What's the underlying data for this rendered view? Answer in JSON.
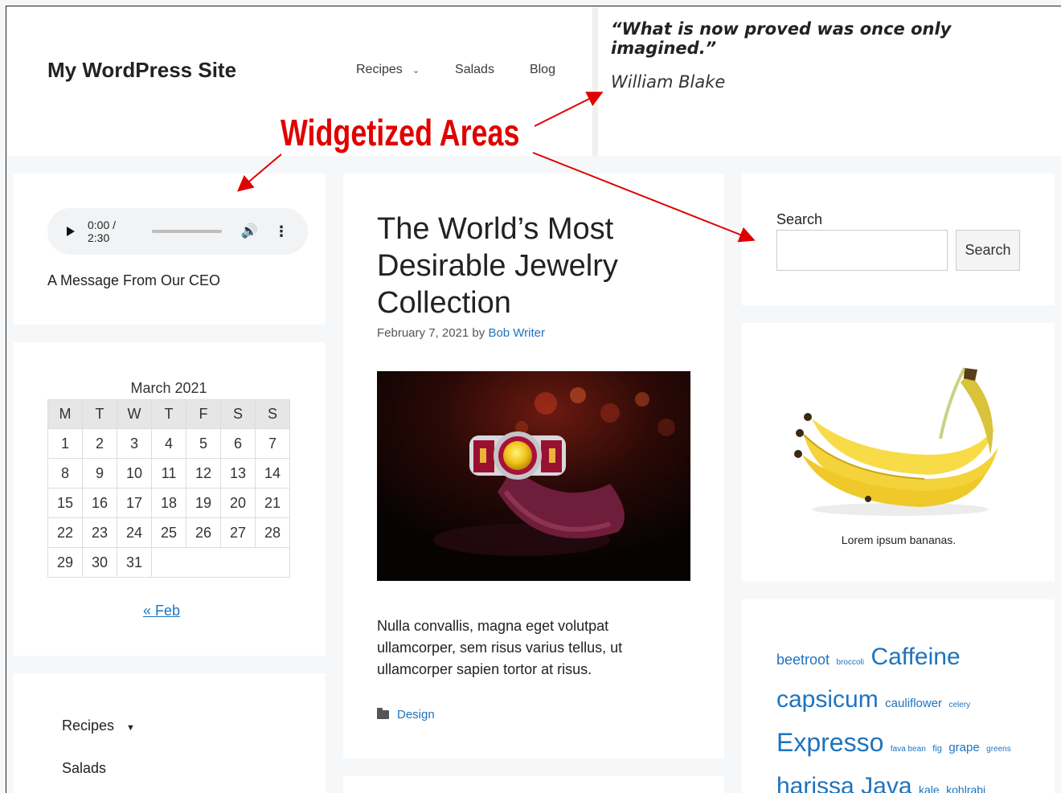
{
  "header": {
    "site_title": "My WordPress Site",
    "nav": [
      {
        "label": "Recipes",
        "has_submenu": true
      },
      {
        "label": "Salads",
        "has_submenu": false
      },
      {
        "label": "Blog",
        "has_submenu": false
      }
    ],
    "quote": "“What is now proved was once only imagined.”",
    "quote_author": "William Blake"
  },
  "annotation": {
    "label": "Widgetized Areas",
    "color": "#e00000"
  },
  "audio_widget": {
    "time": "0:00 / 2:30",
    "progress": 0,
    "caption": "A Message From Our CEO"
  },
  "calendar": {
    "caption": "March 2021",
    "weekdays": [
      "M",
      "T",
      "W",
      "T",
      "F",
      "S",
      "S"
    ],
    "weeks": [
      [
        "1",
        "2",
        "3",
        "4",
        "5",
        "6",
        "7"
      ],
      [
        "8",
        "9",
        "10",
        "11",
        "12",
        "13",
        "14"
      ],
      [
        "15",
        "16",
        "17",
        "18",
        "19",
        "20",
        "21"
      ],
      [
        "22",
        "23",
        "24",
        "25",
        "26",
        "27",
        "28"
      ],
      [
        "29",
        "30",
        "31",
        "",
        "",
        "",
        ""
      ]
    ],
    "prev_link": "« Feb"
  },
  "menu_widget": {
    "items": [
      {
        "label": "Recipes",
        "has_submenu": true
      },
      {
        "label": "Salads",
        "has_submenu": false
      }
    ]
  },
  "post": {
    "title": "The World’s Most Desirable Jewelry Collection",
    "date": "February 7, 2021",
    "by": "by",
    "author": "Bob Writer",
    "excerpt": "Nulla convallis, magna eget volutpat ullamcorper, sem risus varius tellus, ut ullamcorper sapien tortor at risus.",
    "category": "Design"
  },
  "search_widget": {
    "label": "Search",
    "value": "",
    "button_label": "Search"
  },
  "image_widget": {
    "caption": "Lorem ipsum bananas."
  },
  "tag_cloud": {
    "tags": [
      {
        "label": "beetroot",
        "size": 18
      },
      {
        "label": "broccoli",
        "size": 10
      },
      {
        "label": "Caffeine",
        "size": 30
      },
      {
        "label": "capsicum",
        "size": 30
      },
      {
        "label": "cauliflower",
        "size": 15
      },
      {
        "label": "celery",
        "size": 10
      },
      {
        "label": "Expresso",
        "size": 32
      },
      {
        "label": "fava bean",
        "size": 10
      },
      {
        "label": "fig",
        "size": 11
      },
      {
        "label": "grape",
        "size": 15
      },
      {
        "label": "greens",
        "size": 10
      },
      {
        "label": "harissa",
        "size": 30
      },
      {
        "label": "Java",
        "size": 30
      },
      {
        "label": "kale",
        "size": 14
      },
      {
        "label": "kohlrabi",
        "size": 14
      }
    ]
  },
  "colors": {
    "link": "#1e73be",
    "annotation": "#e00000",
    "background": "#f6f7f9"
  }
}
